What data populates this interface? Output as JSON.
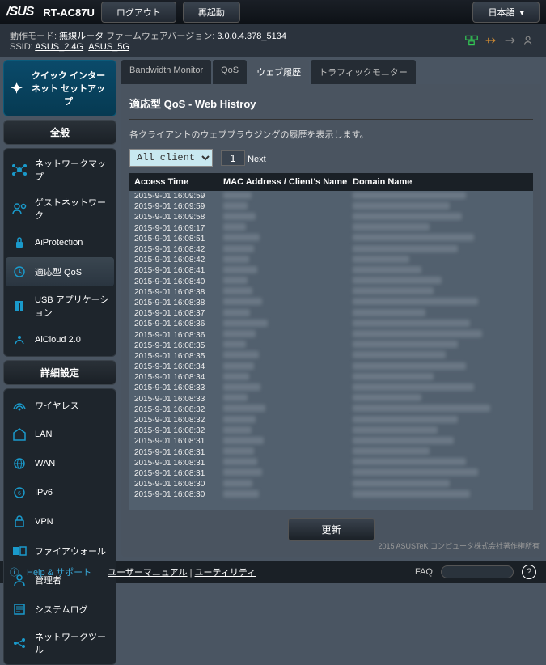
{
  "header": {
    "brand": "/SUS",
    "model": "RT-AC87U",
    "logout": "ログアウト",
    "reboot": "再起動",
    "language": "日本語"
  },
  "info": {
    "mode_label": "動作モード: ",
    "mode": "無線ルータ",
    "fw_label": "  ファームウェアバージョン: ",
    "fw": "3.0.0.4.378_5134",
    "ssid_label": "SSID: ",
    "ssid1": "ASUS_2.4G",
    "ssid2": "ASUS_5G"
  },
  "qis": "クイック インターネット セットアップ",
  "grp1": "全般",
  "grp2": "詳細設定",
  "nav1": [
    "ネットワークマップ",
    "ゲストネットワーク",
    "AiProtection",
    "適応型 QoS",
    "USB アプリケーション",
    "AiCloud 2.0"
  ],
  "nav2": [
    "ワイヤレス",
    "LAN",
    "WAN",
    "IPv6",
    "VPN",
    "ファイアウォール",
    "管理者",
    "システムログ",
    "ネットワークツール"
  ],
  "tabs": [
    "Bandwidth Monitor",
    "QoS",
    "ウェブ履歴",
    "トラフィックモニター"
  ],
  "page": {
    "title": "適応型 QoS - Web Histroy",
    "desc": "各クライアントのウェブブラウジングの履歴を表示します。",
    "client": "All client",
    "page": "1",
    "next": "Next"
  },
  "cols": [
    "Access Time",
    "MAC Address / Client's Name",
    "Domain Name"
  ],
  "times": [
    "2015-9-01 16:09:59",
    "2015-9-01 16:09:59",
    "2015-9-01 16:09:58",
    "2015-9-01 16:09:17",
    "2015-9-01 16:08:51",
    "2015-9-01 16:08:42",
    "2015-9-01 16:08:42",
    "2015-9-01 16:08:41",
    "2015-9-01 16:08:40",
    "2015-9-01 16:08:38",
    "2015-9-01 16:08:38",
    "2015-9-01 16:08:37",
    "2015-9-01 16:08:36",
    "2015-9-01 16:08:36",
    "2015-9-01 16:08:35",
    "2015-9-01 16:08:35",
    "2015-9-01 16:08:34",
    "2015-9-01 16:08:34",
    "2015-9-01 16:08:33",
    "2015-9-01 16:08:33",
    "2015-9-01 16:08:32",
    "2015-9-01 16:08:32",
    "2015-9-01 16:08:32",
    "2015-9-01 16:08:31",
    "2015-9-01 16:08:31",
    "2015-9-01 16:08:31",
    "2015-9-01 16:08:31",
    "2015-9-01 16:08:30",
    "2015-9-01 16:08:30"
  ],
  "update": "更新",
  "foot": {
    "help": "Help & サポート",
    "manual": "ユーザーマニュアル",
    "utility": "ユーティリティ",
    "faq": "FAQ",
    "copy": "2015 ASUSTeK コンピュータ株式会社著作権所有"
  }
}
